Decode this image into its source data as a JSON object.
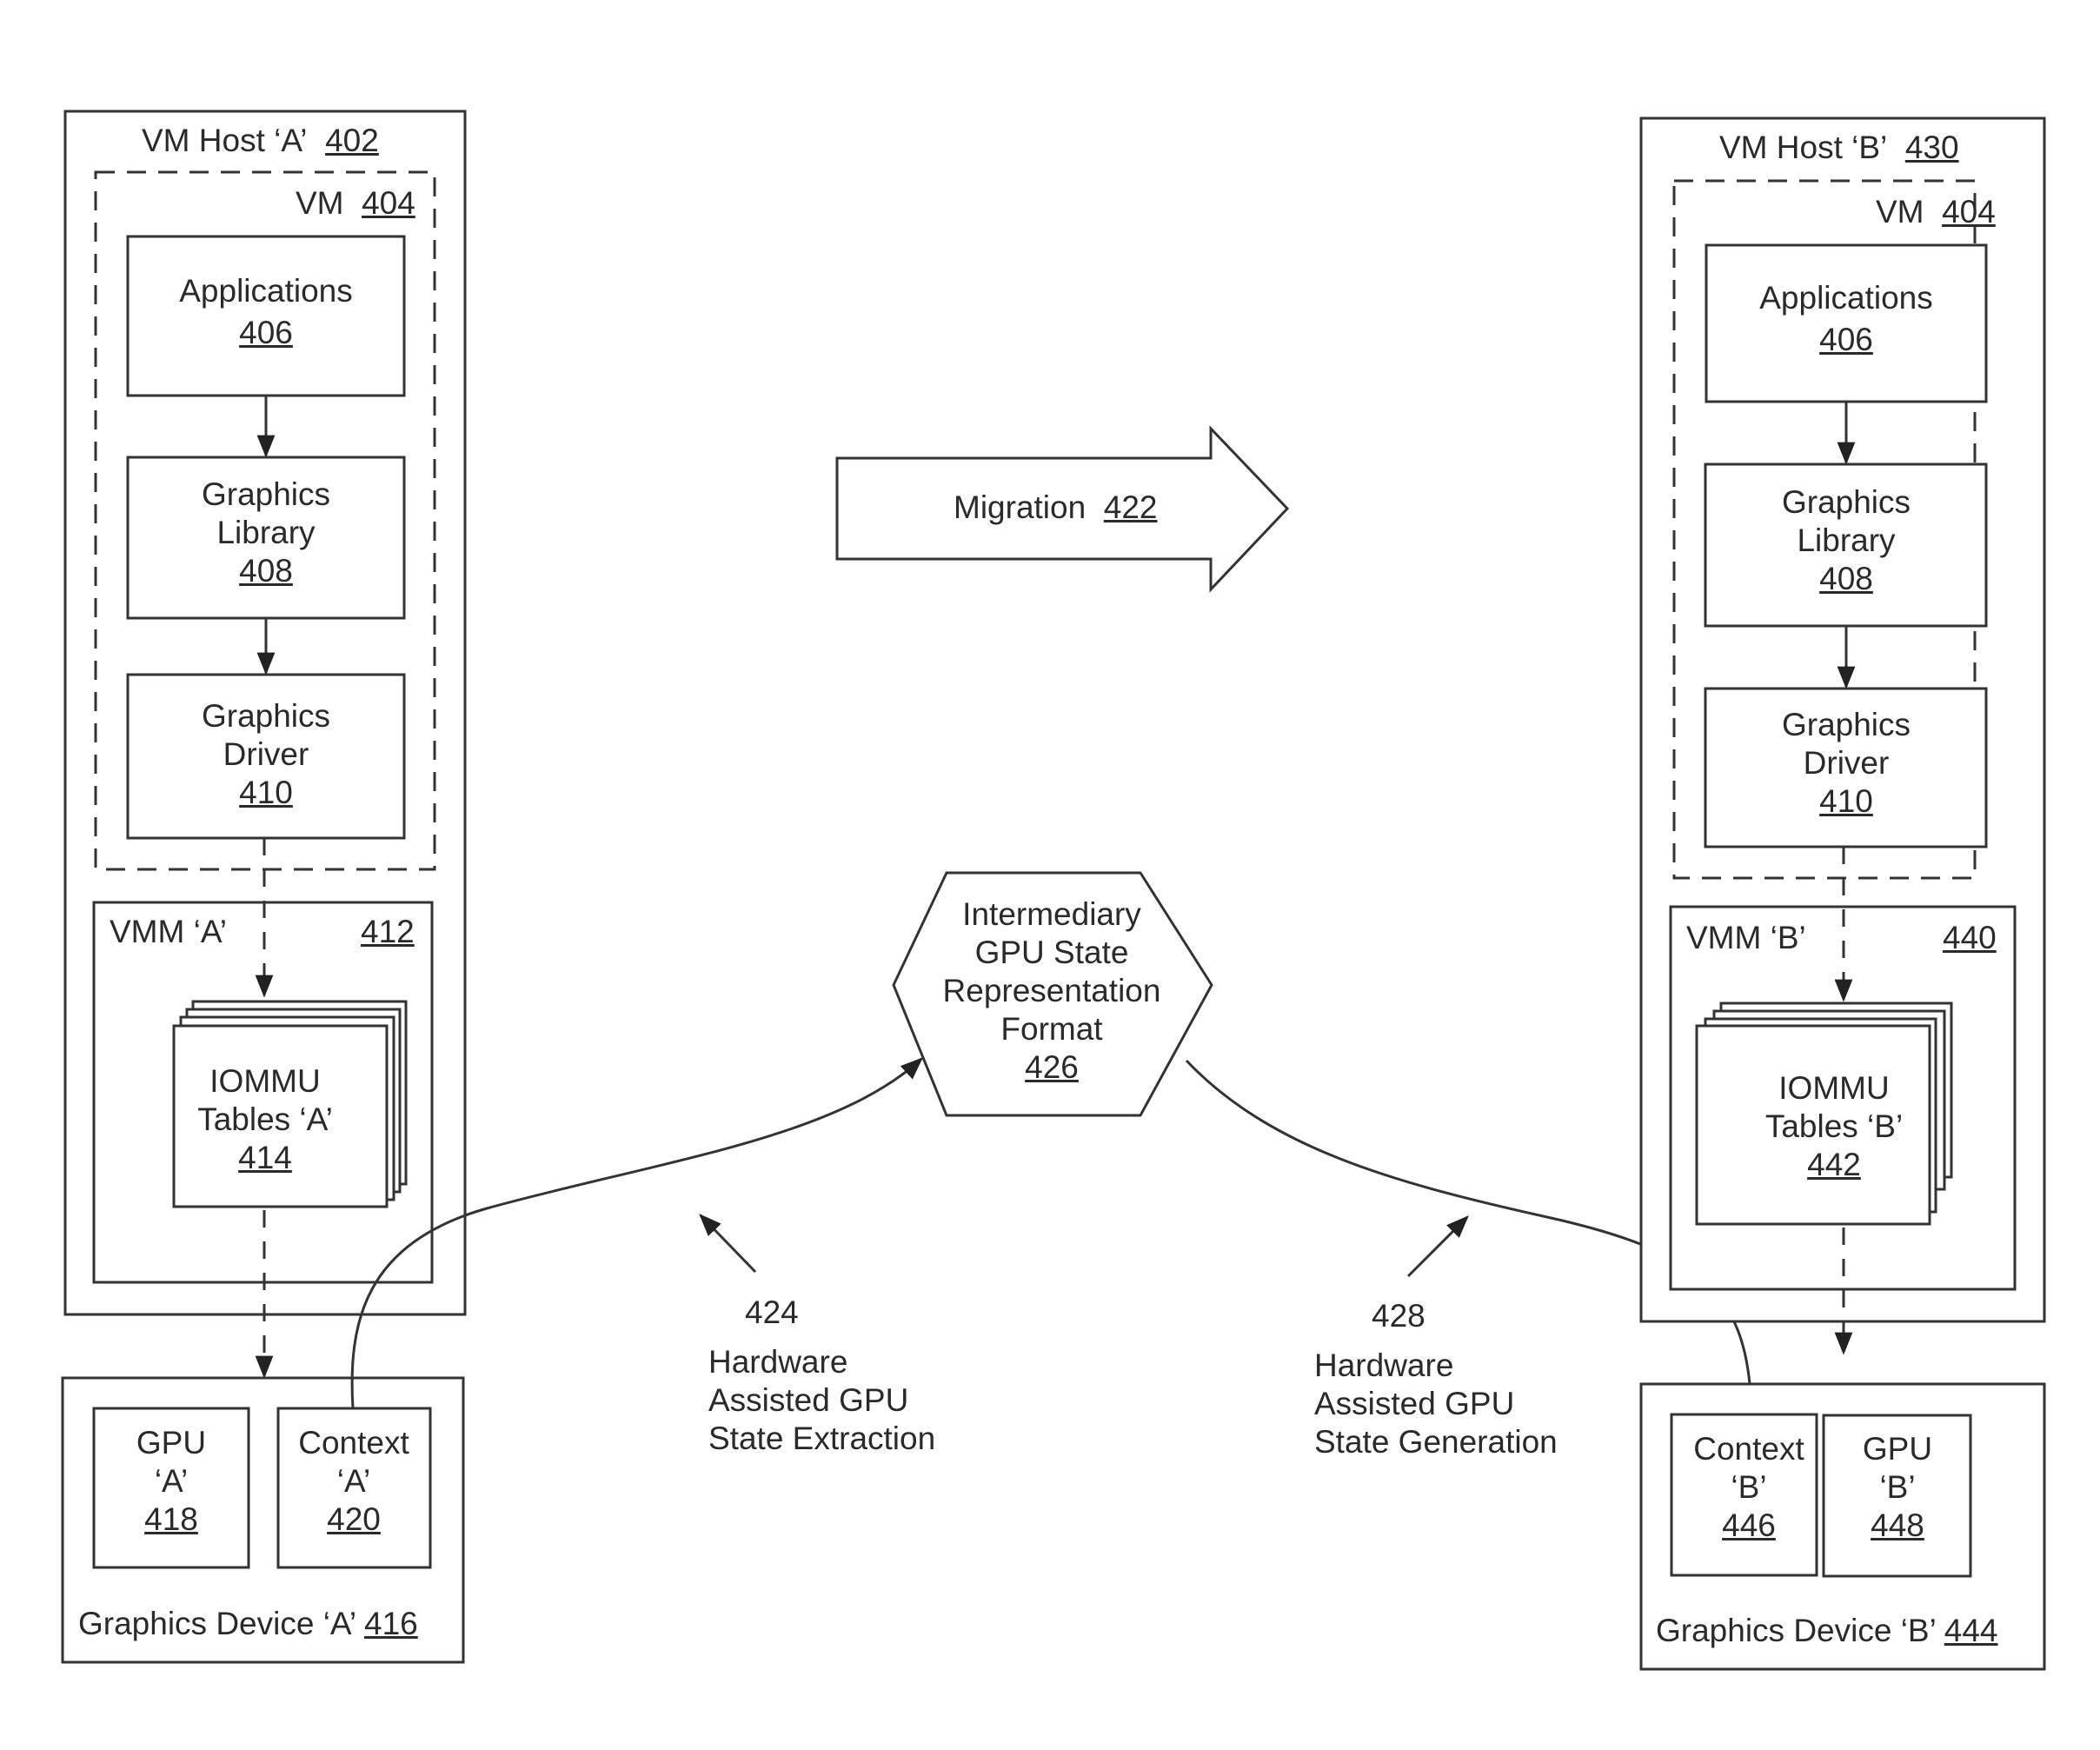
{
  "host_a": {
    "title": "VM Host ‘A’",
    "ref": "402",
    "vm": {
      "title": "VM",
      "ref": "404"
    },
    "applications": {
      "title": "Applications",
      "ref": "406"
    },
    "graphics_library": {
      "line1": "Graphics",
      "line2": "Library",
      "ref": "408"
    },
    "graphics_driver": {
      "line1": "Graphics",
      "line2": "Driver",
      "ref": "410"
    },
    "vmm": {
      "title": "VMM ‘A’",
      "ref": "412"
    },
    "iommu": {
      "line1": "IOMMU",
      "line2": "Tables ‘A’",
      "ref": "414"
    }
  },
  "device_a": {
    "title": "Graphics Device ‘A’",
    "ref": "416",
    "gpu": {
      "line1": "GPU",
      "line2": "‘A’",
      "ref": "418"
    },
    "context": {
      "line1": "Context",
      "line2": "‘A’",
      "ref": "420"
    }
  },
  "migration": {
    "title": "Migration",
    "ref": "422"
  },
  "intermediary": {
    "line1": "Intermediary",
    "line2": "GPU State",
    "line3": "Representation",
    "line4": "Format",
    "ref": "426"
  },
  "extraction": {
    "ref": "424",
    "line1": "Hardware",
    "line2": "Assisted GPU",
    "line3": "State Extraction"
  },
  "generation": {
    "ref": "428",
    "line1": "Hardware",
    "line2": "Assisted GPU",
    "line3": "State Generation"
  },
  "host_b": {
    "title": "VM Host ‘B’",
    "ref": "430",
    "vm": {
      "title": "VM",
      "ref": "404"
    },
    "applications": {
      "title": "Applications",
      "ref": "406"
    },
    "graphics_library": {
      "line1": "Graphics",
      "line2": "Library",
      "ref": "408"
    },
    "graphics_driver": {
      "line1": "Graphics",
      "line2": "Driver",
      "ref": "410"
    },
    "vmm": {
      "title": "VMM ‘B’",
      "ref": "440"
    },
    "iommu": {
      "line1": "IOMMU",
      "line2": "Tables ‘B’",
      "ref": "442"
    }
  },
  "device_b": {
    "title": "Graphics Device ‘B’",
    "ref": "444",
    "context": {
      "line1": "Context",
      "line2": "‘B’",
      "ref": "446"
    },
    "gpu": {
      "line1": "GPU",
      "line2": "‘B’",
      "ref": "448"
    }
  }
}
